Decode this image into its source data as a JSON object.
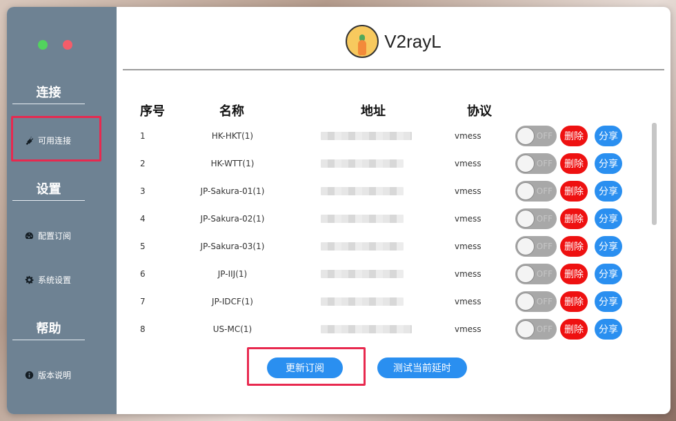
{
  "sidebar": {
    "window_controls": [
      "green-dot",
      "red-dot"
    ],
    "sections": [
      {
        "title": "连接",
        "items": [
          {
            "label": "可用连接",
            "icon": "plug-icon"
          }
        ]
      },
      {
        "title": "设置",
        "items": [
          {
            "label": "配置订阅",
            "icon": "dashboard-icon"
          },
          {
            "label": "系统设置",
            "icon": "gear-icon"
          }
        ]
      },
      {
        "title": "帮助",
        "items": [
          {
            "label": "版本说明",
            "icon": "info-icon"
          }
        ]
      }
    ]
  },
  "header": {
    "app_title": "V2rayL",
    "logo_icon": "carrot-avatar-icon"
  },
  "table": {
    "headers": [
      "序号",
      "名称",
      "地址",
      "协议"
    ],
    "rows": [
      {
        "idx": "1",
        "name": "HK-HKT(1)",
        "protocol": "vmess"
      },
      {
        "idx": "2",
        "name": "HK-WTT(1)",
        "protocol": "vmess"
      },
      {
        "idx": "3",
        "name": "JP-Sakura-01(1)",
        "protocol": "vmess"
      },
      {
        "idx": "4",
        "name": "JP-Sakura-02(1)",
        "protocol": "vmess"
      },
      {
        "idx": "5",
        "name": "JP-Sakura-03(1)",
        "protocol": "vmess"
      },
      {
        "idx": "6",
        "name": "JP-IIJ(1)",
        "protocol": "vmess"
      },
      {
        "idx": "7",
        "name": "JP-IDCF(1)",
        "protocol": "vmess"
      },
      {
        "idx": "8",
        "name": "US-MC(1)",
        "protocol": "vmess"
      }
    ],
    "toggle_label": "OFF",
    "delete_label": "删除",
    "share_label": "分享"
  },
  "actions": {
    "update_subscription": "更新订阅",
    "test_latency": "测试当前延时"
  },
  "colors": {
    "sidebar": "#6e8293",
    "accent": "#2a8ff0",
    "danger": "#ee1111",
    "highlight": "#e8294f"
  }
}
